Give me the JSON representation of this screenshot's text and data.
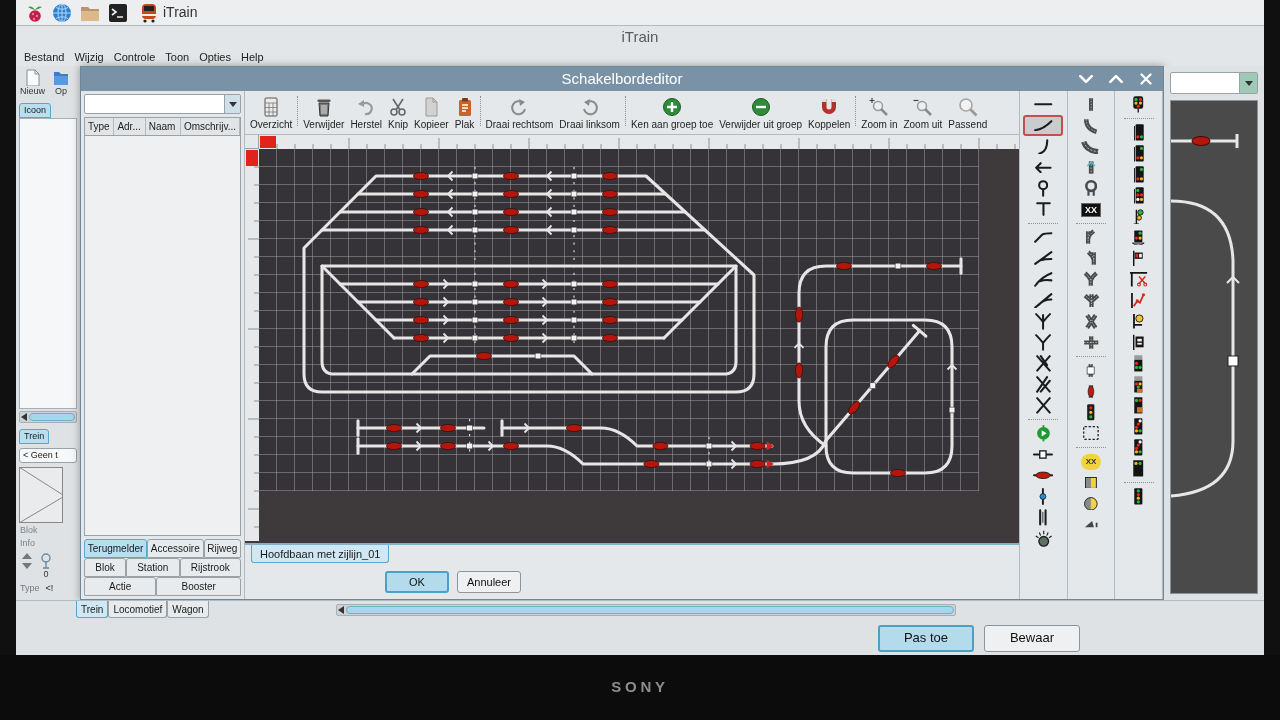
{
  "taskbar": {
    "window_label": "iTrain"
  },
  "main_window": {
    "title": "iTrain",
    "menu": [
      "Bestand",
      "Wijzig",
      "Controle",
      "Toon",
      "Opties",
      "Help"
    ],
    "toolbar": [
      {
        "kind": "new",
        "label": "Nieuw"
      },
      {
        "kind": "open",
        "label": "Op"
      }
    ],
    "list_tabs": [
      {
        "label": "Icoon",
        "selected": true
      }
    ],
    "train_tabs": [
      {
        "label": "Trein",
        "selected": true
      }
    ],
    "train_button": "< Geen t",
    "info_labels": [
      {
        "text": "Blok",
        "disabled": true
      },
      {
        "text": "Info",
        "disabled": true
      }
    ],
    "counter": "0",
    "type_row": [
      {
        "text": "Type",
        "disabled": true
      },
      {
        "text": "<!",
        "disabled": false
      }
    ],
    "bottom_tabs": [
      {
        "label": "Trein",
        "selected": true
      },
      {
        "label": "Locomotief",
        "selected": false
      },
      {
        "label": "Wagon",
        "selected": false
      }
    ],
    "buttons": [
      {
        "label": "Pas toe",
        "default": true
      },
      {
        "label": "Bewaar",
        "default": false
      }
    ]
  },
  "dialog": {
    "title": "Schakelbordeditor",
    "element_table": {
      "columns": [
        "Type",
        "Adr...",
        "Naam",
        "Omschrijv..."
      ]
    },
    "element_tabs": [
      [
        {
          "label": "Terugmelder",
          "selected": true
        },
        {
          "label": "Accessoire",
          "selected": false
        },
        {
          "label": "Rijweg",
          "selected": false
        }
      ],
      [
        {
          "label": "Blok",
          "selected": false
        },
        {
          "label": "Station",
          "selected": false
        },
        {
          "label": "Rijstrook",
          "selected": false
        }
      ],
      [
        {
          "label": "Actie",
          "selected": false
        },
        {
          "label": "Booster",
          "selected": false
        }
      ]
    ],
    "toolbar": [
      [
        {
          "kind": "overview",
          "label": "Overzicht"
        }
      ],
      [
        {
          "kind": "delete",
          "label": "Verwijder"
        },
        {
          "kind": "undo",
          "label": "Herstel"
        },
        {
          "kind": "cut",
          "label": "Knip"
        },
        {
          "kind": "copy",
          "label": "Kopieer"
        },
        {
          "kind": "paste",
          "label": "Plak"
        }
      ],
      [
        {
          "kind": "rotatecw",
          "label": "Draai rechtsom"
        },
        {
          "kind": "rotateccw",
          "label": "Draai linksom"
        }
      ],
      [
        {
          "kind": "groupadd",
          "label": "Ken aan groep toe"
        },
        {
          "kind": "groupremove",
          "label": "Verwijder uit groep"
        },
        {
          "kind": "couple",
          "label": "Koppelen"
        }
      ],
      [
        {
          "kind": "zoomin",
          "label": "Zoom in"
        },
        {
          "kind": "zoomout",
          "label": "Zoom uit"
        },
        {
          "kind": "fit",
          "label": "Passend"
        }
      ]
    ],
    "sheet_tabs": [
      {
        "label": "Hoofdbaan met zijlijn_01",
        "selected": true
      }
    ],
    "buttons": [
      {
        "label": "OK",
        "default": true
      },
      {
        "label": "Annuleer",
        "default": false
      }
    ],
    "palette": {
      "columns": [
        {
          "groups": [
            {
              "tools": [
                {
                  "kind": "line",
                  "selected": false
                },
                {
                  "kind": "curve",
                  "selected": true
                },
                {
                  "kind": "curvesmall",
                  "selected": false
                },
                {
                  "kind": "arrow",
                  "selected": false
                },
                {
                  "kind": "pin",
                  "selected": false
                },
                {
                  "kind": "buffer",
                  "selected": false
                }
              ]
            },
            {
              "tools": [
                {
                  "kind": "switchleft",
                  "selected": false
                },
                {
                  "kind": "switchright",
                  "selected": false
                },
                {
                  "kind": "switchcurve",
                  "selected": false
                },
                {
                  "kind": "switchdouble",
                  "selected": false
                },
                {
                  "kind": "ythree",
                  "selected": false
                },
                {
                  "kind": "y",
                  "selected": false
                },
                {
                  "kind": "slip",
                  "selected": false
                },
                {
                  "kind": "doublecross",
                  "selected": false
                },
                {
                  "kind": "cross",
                  "selected": false
                }
              ]
            },
            {
              "tools": [
                {
                  "kind": "play",
                  "selected": false
                },
                {
                  "kind": "detector",
                  "selected": false
                },
                {
                  "kind": "block",
                  "selected": false
                },
                {
                  "kind": "light",
                  "selected": false
                },
                {
                  "kind": "bars",
                  "selected": false
                },
                {
                  "kind": "lamp",
                  "selected": false
                }
              ]
            }
          ]
        },
        {
          "groups": [
            {
              "tools": [
                {
                  "kind": "track",
                  "selected": false
                },
                {
                  "kind": "trackcurve",
                  "selected": false
                },
                {
                  "kind": "trackcurvesmall",
                  "selected": false
                },
                {
                  "kind": "trackarrow",
                  "selected": false
                },
                {
                  "kind": "turntable",
                  "selected": false
                },
                {
                  "kind": "textbox",
                  "text": "XX",
                  "selected": false
                }
              ]
            },
            {
              "tools": [
                {
                  "kind": "wideswitch",
                  "selected": false
                },
                {
                  "kind": "wideswitch2",
                  "selected": false
                },
                {
                  "kind": "widethree",
                  "selected": false
                },
                {
                  "kind": "widefan",
                  "selected": false
                },
                {
                  "kind": "widecross",
                  "selected": false
                },
                {
                  "kind": "wideplus",
                  "selected": false
                }
              ]
            },
            {
              "tools": [
                {
                  "kind": "whiteblock",
                  "selected": false
                },
                {
                  "kind": "redblock",
                  "selected": false
                },
                {
                  "kind": "trafficlight",
                  "selected": false
                },
                {
                  "kind": "dashed",
                  "selected": false
                }
              ]
            },
            {
              "tools": [
                {
                  "kind": "textdisc",
                  "text": "XX",
                  "selected": false
                },
                {
                  "kind": "halfbox",
                  "selected": false
                },
                {
                  "kind": "halfdisc",
                  "selected": false
                },
                {
                  "kind": "wedge",
                  "selected": false
                }
              ]
            }
          ]
        },
        {
          "groups": [
            {
              "tools": [
                {
                  "kind": "cluster",
                  "selected": false
                }
              ]
            },
            {
              "tools": [
                {
                  "kind": "twolight",
                  "selected": false
                },
                {
                  "kind": "threelight",
                  "selected": false
                },
                {
                  "kind": "threelight",
                  "selected": false
                },
                {
                  "kind": "fivelight",
                  "selected": false
                },
                {
                  "kind": "semaphore",
                  "selected": false
                },
                {
                  "kind": "dish",
                  "selected": false
                },
                {
                  "kind": "flag",
                  "selected": false
                },
                {
                  "kind": "barrier",
                  "selected": false
                },
                {
                  "kind": "zigzag",
                  "selected": false
                },
                {
                  "kind": "ballpost",
                  "selected": false
                },
                {
                  "kind": "sign",
                  "selected": false
                },
                {
                  "kind": "greyhead",
                  "selected": false
                },
                {
                  "kind": "greyheadorange",
                  "selected": false
                },
                {
                  "kind": "orangebox",
                  "selected": false
                },
                {
                  "kind": "diagonal",
                  "selected": false
                },
                {
                  "kind": "diagonal",
                  "selected": false
                },
                {
                  "kind": "yellowtop",
                  "selected": false
                }
              ]
            },
            {
              "tools": [
                {
                  "kind": "vertical",
                  "selected": false
                }
              ]
            }
          ]
        }
      ]
    }
  },
  "bezel": {
    "logo": "SONY"
  }
}
